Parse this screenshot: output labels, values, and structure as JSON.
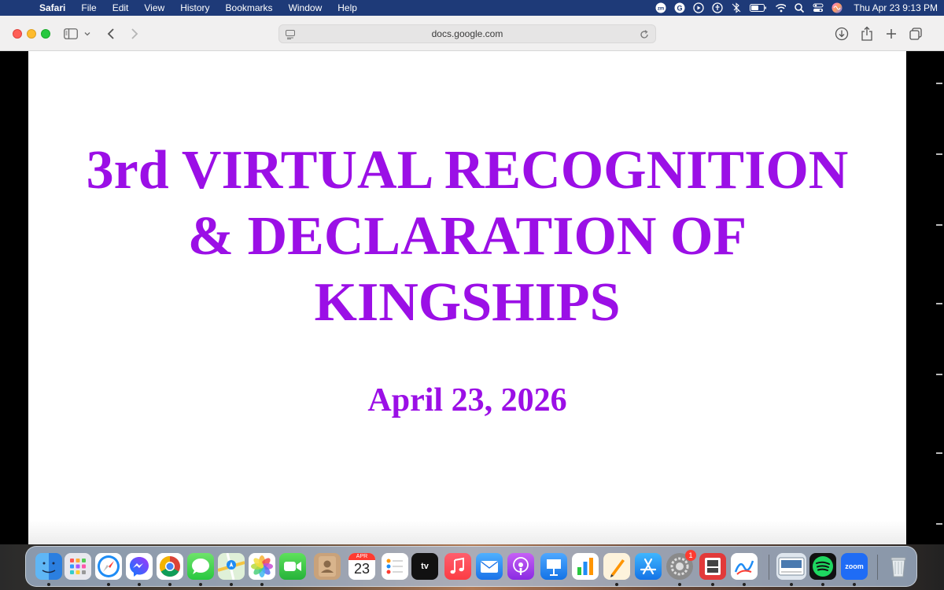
{
  "menubar": {
    "app_name": "Safari",
    "menus": [
      "File",
      "Edit",
      "View",
      "History",
      "Bookmarks",
      "Window",
      "Help"
    ],
    "status_icons": [
      "zoom-status-icon",
      "grammarly-icon",
      "play-icon",
      "accessibility-icon",
      "bluetooth-off-icon",
      "battery-icon",
      "wifi-icon",
      "search-icon",
      "control-center-icon",
      "siri-icon"
    ],
    "clock": "Thu Apr 23  9:13 PM"
  },
  "browser": {
    "url": "docs.google.com"
  },
  "slide": {
    "title_lines": [
      "3rd VIRTUAL RECOGNITION",
      "& DECLARATION OF",
      "KINGSHIPS"
    ],
    "date": "April 23, 2026"
  },
  "dock": {
    "calendar_month": "APR",
    "calendar_day": "23",
    "tv_label": "tv",
    "zoom_label": "zoom",
    "settings_badge": "1",
    "apps": [
      "finder",
      "launchpad",
      "safari",
      "messenger",
      "chrome",
      "messages",
      "maps",
      "photos",
      "facetime",
      "contacts",
      "calendar",
      "reminders",
      "apple-tv",
      "music",
      "mail",
      "podcasts",
      "keynote",
      "numbers",
      "pages",
      "app-store",
      "system-settings",
      "photo-booth",
      "freeform",
      "preview",
      "spotify",
      "zoom",
      "trash"
    ]
  },
  "colors": {
    "menubar_bg": "#1e3a78",
    "title_purple": "#9b0fe6",
    "slide_bg": "#ffffff"
  }
}
